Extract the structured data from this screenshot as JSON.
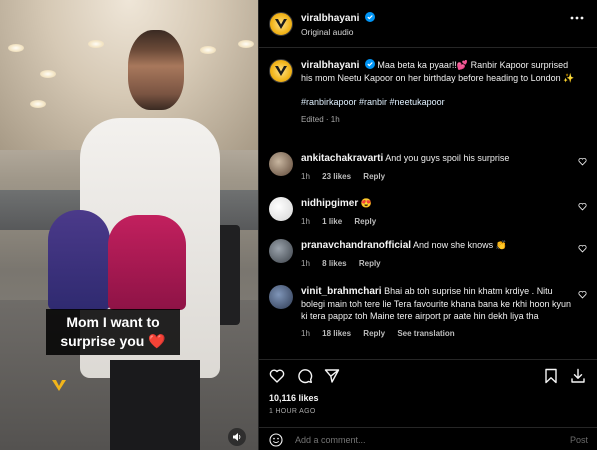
{
  "header": {
    "username": "viralbhayani",
    "subtitle": "Original audio"
  },
  "video": {
    "caption_line1": "Mom I want to",
    "caption_line2": "surprise you",
    "caption_emoji": "❤️"
  },
  "caption_post": {
    "username": "viralbhayani",
    "text": "Maa beta ka pyaar!!💕 Ranbir Kapoor surprised his mom Neetu Kapoor on her birthday before heading to London ✨",
    "hashtags": "#ranbirkapoor #ranbir #neetukapoor",
    "meta": "Edited · 1h"
  },
  "comments": [
    {
      "username": "ankitachakravarti",
      "text": "And you guys spoil his surprise",
      "time": "1h",
      "likes": "23 likes",
      "reply": "Reply",
      "translation": ""
    },
    {
      "username": "nidhipgimer",
      "text": "😍",
      "time": "1h",
      "likes": "1 like",
      "reply": "Reply",
      "translation": ""
    },
    {
      "username": "pranavchandranofficial",
      "text": "And now she knows 👏",
      "time": "1h",
      "likes": "8 likes",
      "reply": "Reply",
      "translation": ""
    },
    {
      "username": "vinit_brahmchari",
      "text": "Bhai ab toh suprise hin khatm krdiye . Nitu bolegi main toh tere lie Tera favourite khana bana ke rkhi hoon kyun ki tera pappz toh Maine tere airport pr aate hin dekh liya tha",
      "time": "1h",
      "likes": "18 likes",
      "reply": "Reply",
      "translation": "See translation"
    }
  ],
  "footer": {
    "likes": "10,116 likes",
    "time_ago": "1 HOUR AGO",
    "comment_placeholder": "Add a comment...",
    "post_label": "Post"
  },
  "icons": {
    "more": "more-horizontal-icon",
    "verified": "verified-badge-icon",
    "like": "heart-icon",
    "comment": "comment-icon",
    "share": "share-icon",
    "save": "bookmark-icon",
    "download": "download-icon",
    "emoji": "emoji-icon",
    "mute": "speaker-icon"
  },
  "colors": {
    "background": "#000000",
    "verified": "#0095f6",
    "brand_yellow": "#f2b51a"
  }
}
